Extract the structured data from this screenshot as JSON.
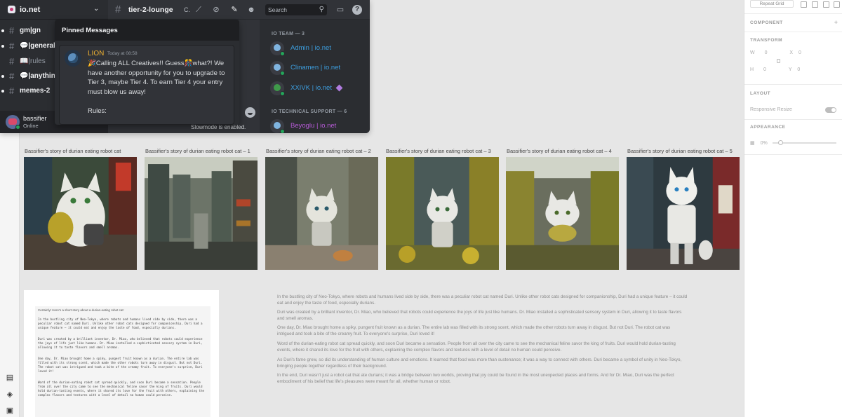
{
  "discord": {
    "server_name": "io.net",
    "channels": [
      {
        "name": "gm|gn",
        "unread": true
      },
      {
        "name": "💬|general",
        "unread": true
      },
      {
        "name": "📖|rules",
        "unread": false
      },
      {
        "name": "💬|anythin",
        "unread": true
      },
      {
        "name": "memes-2",
        "unread": true
      }
    ],
    "user": {
      "name": "bassifier",
      "status": "Online"
    },
    "current_channel": "tier-2-lounge",
    "topbar_extra": "C.",
    "search_placeholder": "Search",
    "pinned": {
      "title": "Pinned Messages",
      "author": "LION",
      "time": "Today at 08:58",
      "body": "🎉Calling ALL Creatives!! Guess🎊what?! We have another opportunity for you to upgrade to Tier 3, maybe Tier 4. To earn Tier 4 your entry must blow us away!",
      "rules": "Rules:"
    },
    "slowmode_text": "Slowmode is enabled.",
    "member_groups": [
      {
        "heading": "IO TEAM — 3"
      },
      {
        "heading": "IO TECHNICAL SUPPORT — 6"
      }
    ],
    "members": [
      {
        "name": "Admin | io.net",
        "color": "#3d9fe0"
      },
      {
        "name": "Clinamen | io.net",
        "color": "#3d9fe0"
      },
      {
        "name": "XXIVK | io.net",
        "color": "#3d9fe0"
      },
      {
        "name": "Beyoglu | io.net",
        "color": "#b65ad6"
      }
    ]
  },
  "inspector": {
    "repeat_grid": "Repeat Grid",
    "component": "COMPONENT",
    "transform": "TRANSFORM",
    "w_label": "W",
    "w_value": "0",
    "x_label": "X",
    "x_value": "0",
    "h_label": "H",
    "h_value": "0",
    "y_label": "Y",
    "y_value": "0",
    "layout": "LAYOUT",
    "responsive_resize": "Responsive Resize",
    "appearance": "APPEARANCE",
    "opacity": "0%"
  },
  "images": [
    {
      "label": "Bassifier's story of durian eating robot cat"
    },
    {
      "label": "Bassifier's story of durian eating robot cat – 1"
    },
    {
      "label": "Bassifier's story of durian eating robot cat – 2"
    },
    {
      "label": "Bassifier's story of durian eating robot cat – 3"
    },
    {
      "label": "Bassifier's story of durian eating robot cat – 4"
    },
    {
      "label": "Bassifier's story of durian eating robot cat – 5"
    }
  ],
  "doc": {
    "title": "Certainly! Here's a short story about a durian-eating robot cat:",
    "paragraphs": [
      "In the bustling city of Neo-Tokyo, where robots and humans lived side by side, there was a peculiar robot cat named Duri. Unlike other robot cats designed for companionship, Duri had a unique feature – it could eat and enjoy the taste of food, especially durians.",
      "Duri was created by a brilliant inventor, Dr. Miao, who believed that robots could experience the joys of life just like humans. Dr. Miao installed a sophisticated sensory system in Duri, allowing it to taste flavors and smell aromas.",
      "One day, Dr. Miao brought home a spiky, pungent fruit known as a durian. The entire lab was filled with its strong scent, which made the other robots turn away in disgust. But not Duri. The robot cat was intrigued and took a bite of the creamy fruit. To everyone's surprise, Duri loved it!",
      "Word of the durian-eating robot cat spread quickly, and soon Duri became a sensation. People from all over the city came to see the mechanical feline savor the king of fruits. Duri would hold durian-tasting events, where it shared its love for the fruit with others, explaining the complex flavors and textures with a level of detail no human could perceive."
    ]
  },
  "story": [
    "In the bustling city of Neo-Tokyo, where robots and humans lived side by side, there was a peculiar robot cat named Duri. Unlike other robot cats designed for companionship, Duri had a unique feature – it could eat and enjoy the taste of food, especially durians.",
    "Duri was created by a brilliant inventor, Dr. Miao, who believed that robots could experience the joys of life just like humans. Dr. Miao installed a sophisticated sensory system in Duri, allowing it to taste flavors and smell aromas.",
    "One day, Dr. Miao brought home a spiky, pungent fruit known as a durian. The entire lab was filled with its strong scent, which made the other robots turn away in disgust. But not Duri. The robot cat was intrigued and took a bite of the creamy fruit. To everyone's surprise, Duri loved it!",
    "Word of the durian-eating robot cat spread quickly, and soon Duri became a sensation. People from all over the city came to see the mechanical feline savor the king of fruits. Duri would hold durian-tasting events, where it shared its love for the fruit with others, explaining the complex flavors and textures with a level of detail no human could perceive.",
    "As Duri's fame grew, so did its understanding of human culture and emotions. It learned that food was more than sustenance; it was a way to connect with others. Duri became a symbol of unity in Neo-Tokyo, bringing people together regardless of their background.",
    "In the end, Duri wasn't just a robot cat that ate durians; it was a bridge between two worlds, proving that joy could be found in the most unexpected places and forms. And for Dr. Miao, Duri was the perfect embodiment of his belief that life's pleasures were meant for all, whether human or robot."
  ]
}
